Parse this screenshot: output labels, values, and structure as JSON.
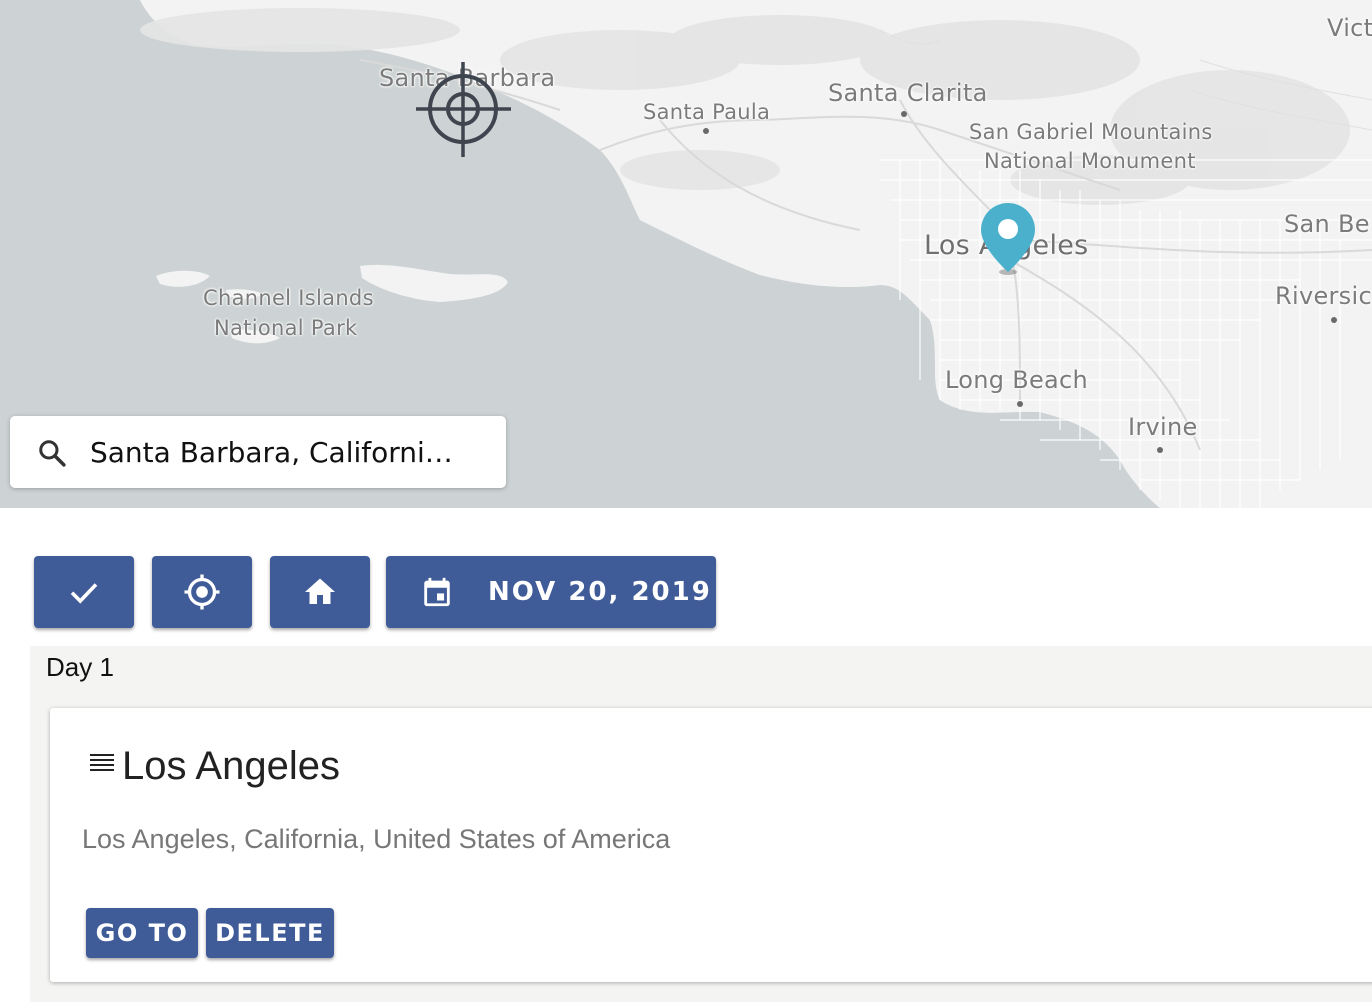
{
  "map": {
    "labels": {
      "santa_barbara": "Santa Barbara",
      "santa_paula": "Santa Paula",
      "santa_clarita": "Santa Clarita",
      "san_gabriel_1": "San Gabriel Mountains",
      "san_gabriel_2": "National Monument",
      "los_angeles": "Los Angeles",
      "channel_1": "Channel Islands",
      "channel_2": "National Park",
      "long_beach": "Long Beach",
      "irvine": "Irvine",
      "san_bernardino_partial": "San Ber",
      "riverside_partial": "Riversic",
      "victorville_partial": "Victo"
    },
    "colors": {
      "water": "#cdd3d4",
      "land": "#f2f2f2",
      "marker": "#4bb0cc"
    }
  },
  "search": {
    "value": "Santa Barbara, Californi…",
    "icon": "search-icon"
  },
  "toolbar": {
    "confirm_icon": "check-icon",
    "locate_icon": "crosshair-icon",
    "home_icon": "home-icon",
    "calendar_icon": "calendar-icon",
    "date_label": "NOV 20, 2019",
    "accent": "#3f5b98"
  },
  "day": {
    "title": "Day 1",
    "stops": [
      {
        "name": "Los Angeles",
        "address": "Los Angeles, California, United States of America",
        "goto_label": "GO TO",
        "delete_label": "DELETE"
      }
    ]
  }
}
